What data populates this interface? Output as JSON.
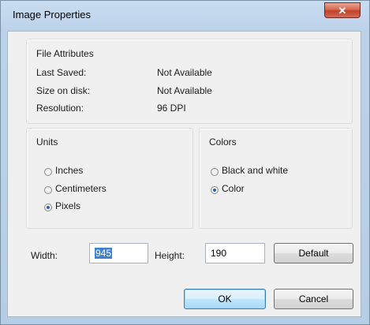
{
  "window": {
    "title": "Image Properties",
    "close_glyph": "✕"
  },
  "file_attributes": {
    "heading": "File Attributes",
    "rows": [
      {
        "label": "Last Saved:",
        "value": "Not Available"
      },
      {
        "label": "Size on disk:",
        "value": "Not Available"
      },
      {
        "label": "Resolution:",
        "value": "96 DPI"
      }
    ]
  },
  "units": {
    "heading": "Units",
    "options": [
      {
        "label": "Inches",
        "checked": false
      },
      {
        "label": "Centimeters",
        "checked": false
      },
      {
        "label": "Pixels",
        "checked": true
      }
    ]
  },
  "colors": {
    "heading": "Colors",
    "options": [
      {
        "label": "Black and white",
        "checked": false
      },
      {
        "label": "Color",
        "checked": true
      }
    ]
  },
  "size": {
    "width_label": "Width:",
    "width_value": "945",
    "height_label": "Height:",
    "height_value": "190"
  },
  "buttons": {
    "default": "Default",
    "ok": "OK",
    "cancel": "Cancel"
  },
  "style": {
    "selection": "#3f7fd6",
    "radio_dot": "#2a62b8",
    "close_red": "#c3402b"
  }
}
